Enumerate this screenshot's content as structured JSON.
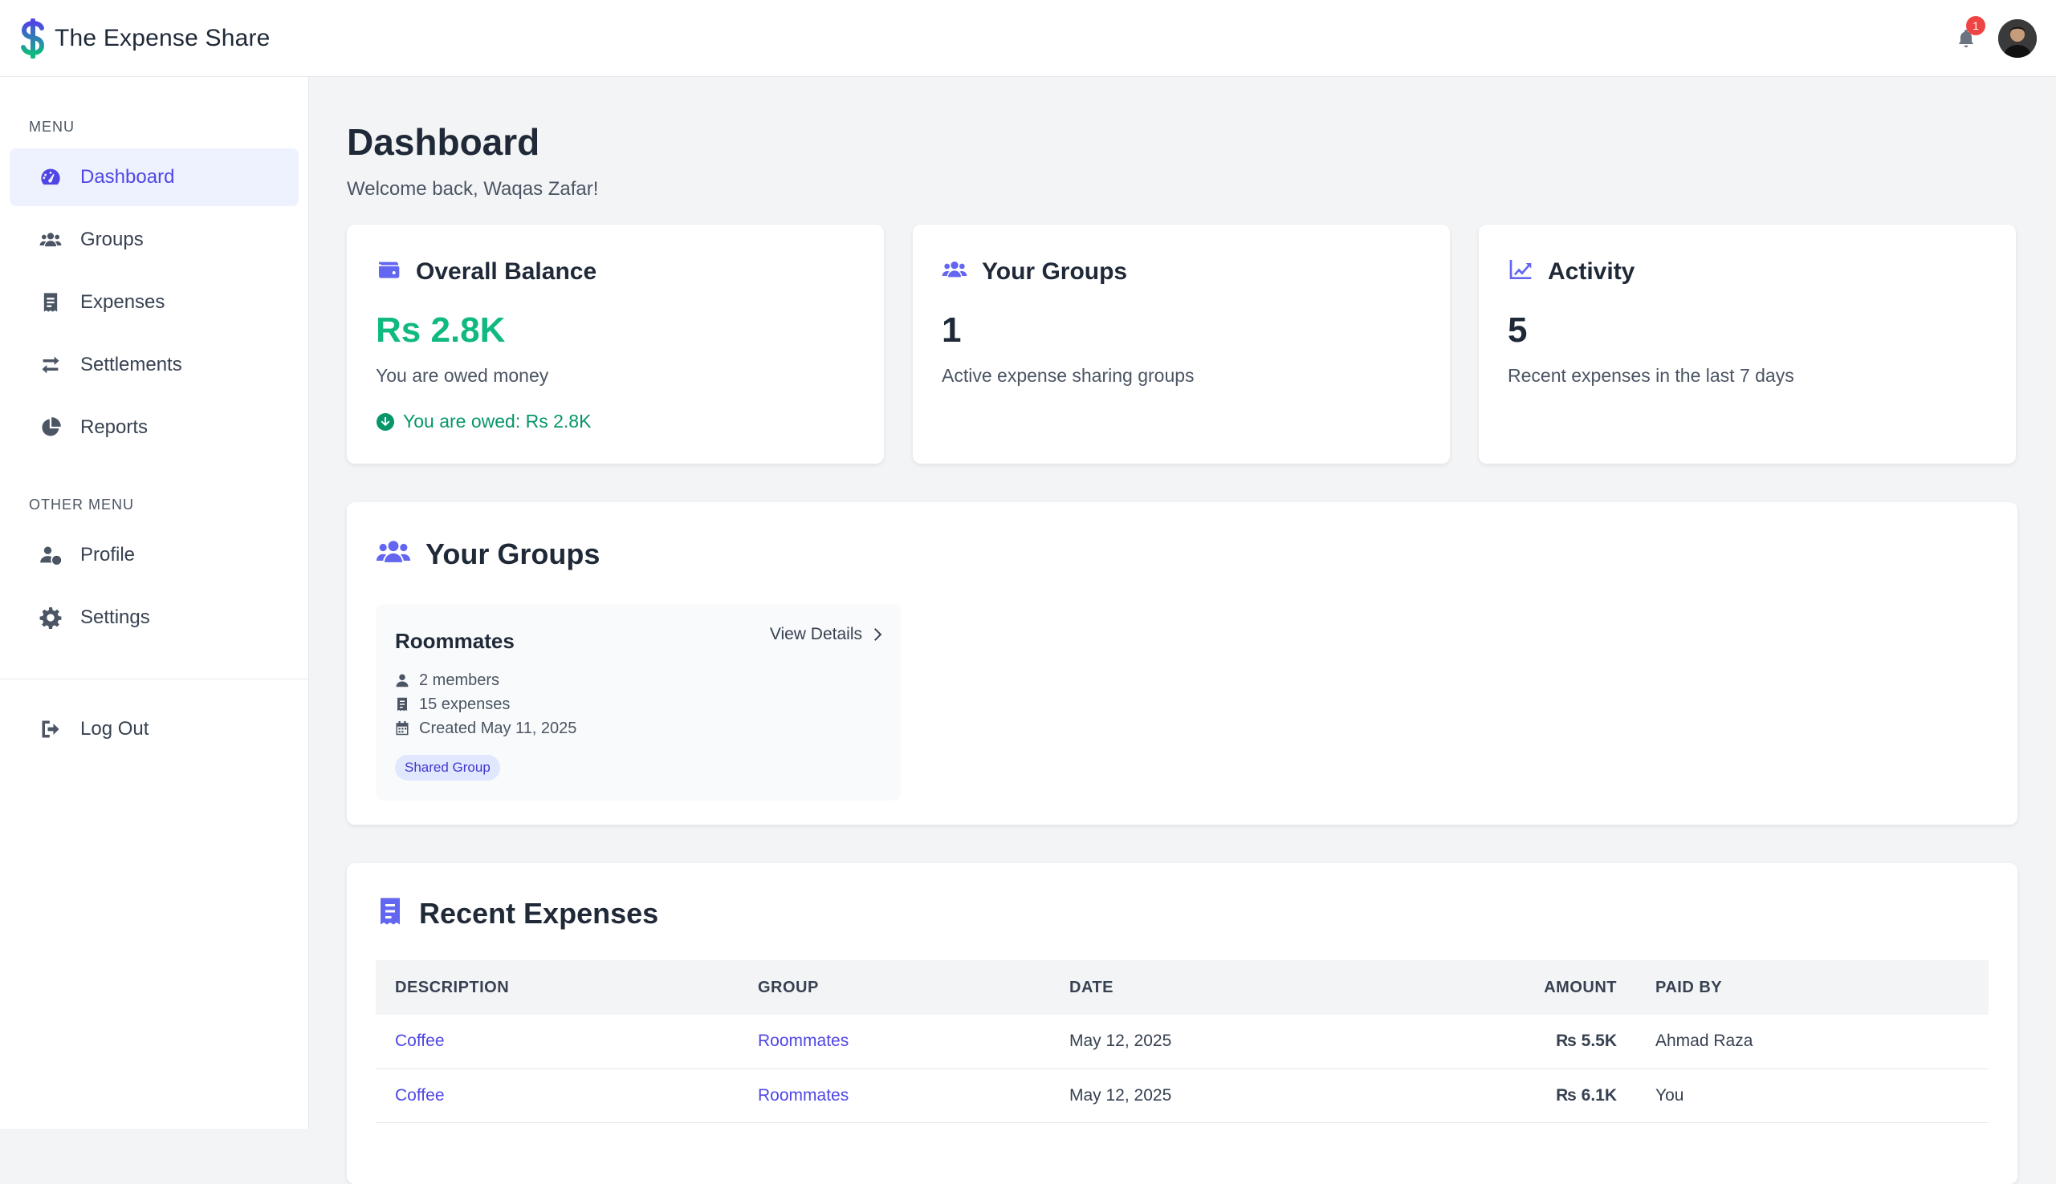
{
  "app": {
    "title": "The Expense Share",
    "notification_count": "1"
  },
  "colors": {
    "accent": "#4f46e5",
    "accent_soft": "#eef2ff",
    "positive": "#10b981",
    "badge": "#ef4444"
  },
  "sidebar": {
    "menu_heading": "MENU",
    "items": [
      {
        "label": "Dashboard",
        "icon": "gauge-icon",
        "active": true
      },
      {
        "label": "Groups",
        "icon": "users-icon"
      },
      {
        "label": "Expenses",
        "icon": "receipt-icon"
      },
      {
        "label": "Settlements",
        "icon": "exchange-icon"
      },
      {
        "label": "Reports",
        "icon": "pie-chart-icon"
      }
    ],
    "other_heading": "OTHER MENU",
    "other_items": [
      {
        "label": "Profile",
        "icon": "user-cog-icon"
      },
      {
        "label": "Settings",
        "icon": "gear-icon"
      }
    ],
    "logout_label": "Log Out"
  },
  "main": {
    "title": "Dashboard",
    "welcome": "Welcome back, Waqas Zafar!",
    "cards": [
      {
        "title": "Overall Balance",
        "value": "Rs 2.8K",
        "sub": "You are owed money",
        "note": "You are owed: Rs 2.8K",
        "icon": "wallet-icon"
      },
      {
        "title": "Your Groups",
        "value": "1",
        "sub": "Active expense sharing groups",
        "icon": "users-icon"
      },
      {
        "title": "Activity",
        "value": "5",
        "sub": "Recent expenses in the last 7 days",
        "icon": "line-chart-icon"
      }
    ],
    "groups_panel": {
      "title": "Your Groups",
      "group": {
        "name": "Roommates",
        "view_details": "View Details",
        "members": "2 members",
        "expenses": "15 expenses",
        "created": "Created May 11, 2025",
        "tag": "Shared Group"
      }
    },
    "expenses_panel": {
      "title": "Recent Expenses",
      "columns": [
        "DESCRIPTION",
        "GROUP",
        "DATE",
        "AMOUNT",
        "PAID BY"
      ],
      "rows": [
        {
          "description": "Coffee",
          "group": "Roommates",
          "date": "May 12, 2025",
          "amount": "₨ 5.5K",
          "paid_by": "Ahmad Raza"
        },
        {
          "description": "Coffee",
          "group": "Roommates",
          "date": "May 12, 2025",
          "amount": "₨ 6.1K",
          "paid_by": "You"
        }
      ]
    }
  }
}
